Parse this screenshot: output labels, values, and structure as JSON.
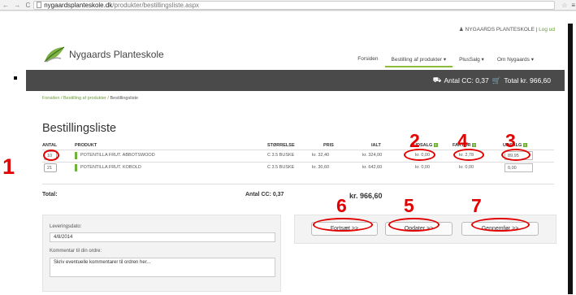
{
  "browser": {
    "url_host": "nygaardsplanteskole.dk",
    "url_path": "/produkter/bestillingsliste.aspx",
    "nav_glyphs": "← → C"
  },
  "header": {
    "user_name": "NYGAARDS PLANTESKOLE",
    "separator": " | ",
    "logout": "Log ud",
    "logo_text": "Nygaards Planteskole"
  },
  "nav": {
    "items": [
      "Forsiden",
      "Bestilling af produkter ▾",
      "PlusSalg ▾",
      "Om Nygaards ▾"
    ]
  },
  "cartbar": {
    "cc_label": "Antal CC: 0,37",
    "total_label": "Total kr. 966,60"
  },
  "breadcrumb": {
    "items": [
      "Forsiden",
      "Bestilling af produkter",
      "Bestillingsliste"
    ],
    "separator": "/"
  },
  "page_title": "Bestillingsliste",
  "table": {
    "headers": {
      "antal": "ANTAL",
      "produkt": "PRODUKT",
      "storrelse": "STØRRELSE",
      "pris": "PRIS",
      "ialt": "IALT",
      "udsalg": "UDSALG",
      "faktor": "FAKTOR",
      "udsalg2": "UDSALG"
    },
    "help_glyph": "?",
    "rows": [
      {
        "antal": "10",
        "produkt": "POTENTILLA FRUT. ABBOTSWOOD",
        "storrelse": "C 3.5 BUSKE",
        "pris": "kr. 32,40",
        "ialt": "kr. 324,00",
        "udsalg": "kr. 0,00",
        "faktor": "kr. 2,78",
        "udsalg2": "89,95"
      },
      {
        "antal": "21",
        "produkt": "POTENTILLA FRUT. KOBOLD",
        "storrelse": "C 3.5 BUSKE",
        "pris": "kr. 30,60",
        "ialt": "kr. 642,60",
        "udsalg": "kr. 0,00",
        "faktor": "kr. 0,00",
        "udsalg2": "0,00"
      }
    ],
    "total_label": "Total:",
    "total_cc": "Antal CC: 0,37",
    "total_sum": "kr. 966,60"
  },
  "buttons": {
    "continue": "Fortsæt >>",
    "update": "Opdater >>",
    "save": "Gennemfør >>"
  },
  "form": {
    "date_label": "Leveringsdato:",
    "date_value": "4/8/2014",
    "comment_label": "Kommentar til din ordre:",
    "comment_placeholder": "Skriv eventuelle kommentarer til ordren her..."
  },
  "annotations": {
    "n1": "1",
    "n2": "2",
    "n3": "3",
    "n4": "4",
    "n5": "5",
    "n6": "6",
    "n7": "7",
    "color": "#e30000"
  },
  "colors": {
    "accent": "#6fb23a",
    "darkbar": "#4a4a4a"
  }
}
